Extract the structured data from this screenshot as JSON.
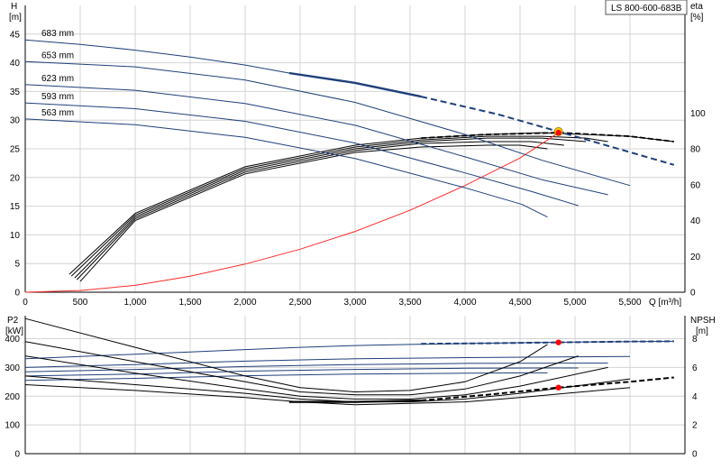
{
  "title_box": "LS 800-600-683B",
  "chart_data": [
    {
      "type": "line",
      "panel": "head-efficiency",
      "xlabel": "Q [m³/h]",
      "ylabel_left": {
        "name": "H",
        "unit": "[m]"
      },
      "ylabel_right": {
        "name": "eta",
        "unit": "[%]"
      },
      "xlim": [
        0,
        6000
      ],
      "ylim_left": [
        0,
        50
      ],
      "ylim_right": [
        0,
        160
      ],
      "x_ticks": [
        0,
        500,
        1000,
        1500,
        2000,
        2500,
        3000,
        3500,
        4000,
        4500,
        5000,
        5500
      ],
      "x_tick_labels": [
        "0",
        "500",
        "1,000",
        "1,500",
        "2,000",
        "2,500",
        "3,000",
        "3,500",
        "4,000",
        "4,500",
        "5,000",
        "5,500"
      ],
      "y_ticks_left": [
        0,
        5,
        10,
        15,
        20,
        25,
        30,
        35,
        40,
        45
      ],
      "y_ticks_right": [
        0,
        20,
        40,
        60,
        80,
        100
      ],
      "grid": true,
      "head_curves": [
        {
          "name": "683 mm",
          "x": [
            0,
            500,
            1000,
            1500,
            2000,
            2400
          ],
          "y": [
            44.0,
            43.2,
            42.2,
            41.0,
            39.6,
            38.2
          ],
          "x2": [
            2400,
            3000,
            3600
          ],
          "y2": [
            38.2,
            36.5,
            34.1
          ],
          "x3": [
            3600,
            4300,
            4850,
            5900
          ],
          "y3": [
            34.1,
            31.0,
            28.0,
            22.2
          ],
          "color": "#1f3f7a"
        },
        {
          "name": "653 mm",
          "x": [
            0,
            1000,
            2000,
            3000,
            4000,
            4700,
            5500
          ],
          "y": [
            40.2,
            39.3,
            37.0,
            33.1,
            27.5,
            23.0,
            18.6
          ],
          "color": "#1f3f7a"
        },
        {
          "name": "623 mm",
          "x": [
            0,
            1000,
            2000,
            3000,
            4000,
            4700,
            5300
          ],
          "y": [
            36.2,
            35.2,
            32.9,
            29.1,
            23.6,
            19.6,
            17.0
          ],
          "color": "#1f3f7a"
        },
        {
          "name": "593 mm",
          "x": [
            0,
            1000,
            2000,
            3000,
            4000,
            4600,
            5030
          ],
          "y": [
            33.0,
            32.0,
            29.8,
            26.0,
            20.8,
            17.6,
            15.1
          ],
          "color": "#1f3f7a"
        },
        {
          "name": "563 mm",
          "x": [
            0,
            1000,
            2000,
            3000,
            4000,
            4520,
            4750
          ],
          "y": [
            30.2,
            29.2,
            27.0,
            23.3,
            18.2,
            15.3,
            13.1
          ],
          "color": "#1f3f7a"
        }
      ],
      "system_curve": {
        "x": [
          0,
          500,
          1000,
          1500,
          2000,
          2500,
          3000,
          3500,
          4000,
          4500,
          4850
        ],
        "y": [
          0,
          0.3,
          1.2,
          2.8,
          4.9,
          7.5,
          10.6,
          14.3,
          18.6,
          23.4,
          27.8
        ],
        "color": "#ff2a2a"
      },
      "eta_curves": [
        {
          "x": [
            400,
            1000,
            2000,
            3000,
            3600,
            4200,
            4700,
            5100,
            5500,
            5900
          ],
          "y": [
            10,
            44,
            70,
            82,
            86,
            88,
            89,
            88,
            87,
            84
          ]
        },
        {
          "x": [
            420,
            1000,
            2000,
            3000,
            3600,
            4200,
            4700,
            5100,
            5300
          ],
          "y": [
            9,
            43,
            69,
            81,
            85,
            87,
            87,
            86,
            84
          ]
        },
        {
          "x": [
            450,
            1000,
            2000,
            3000,
            3600,
            4200,
            4700,
            5100
          ],
          "y": [
            8,
            42,
            68,
            80,
            84,
            86,
            86,
            84
          ]
        },
        {
          "x": [
            470,
            1000,
            2000,
            3000,
            3600,
            4200,
            4600,
            4900
          ],
          "y": [
            7,
            41,
            67,
            79,
            83,
            84,
            84,
            82
          ]
        },
        {
          "x": [
            500,
            1000,
            2000,
            3000,
            3600,
            4200,
            4500,
            4750
          ],
          "y": [
            6,
            40,
            66,
            78,
            81,
            82,
            82,
            80
          ]
        }
      ],
      "eta_dashed_segment": {
        "x": [
          3600,
          4200,
          4850,
          5500,
          5900
        ],
        "y": [
          86,
          88,
          89,
          87,
          84
        ]
      },
      "duty_point": {
        "x": 4850,
        "y": 28.0,
        "color": "#ffcc00"
      },
      "eta_point": {
        "x": 4850,
        "y_eta": 89,
        "color": "#ff0000"
      }
    },
    {
      "type": "line",
      "panel": "power-npsh",
      "ylabel_left": {
        "name": "P2",
        "unit": "[kW]"
      },
      "ylabel_right": {
        "name": "NPSH",
        "unit": "[m]"
      },
      "xlim": [
        0,
        6000
      ],
      "ylim_left": [
        0,
        480
      ],
      "ylim_right": [
        0,
        9.6
      ],
      "y_ticks_left": [
        0,
        100,
        200,
        300,
        400
      ],
      "y_ticks_right": [
        0,
        2,
        4,
        6,
        8
      ],
      "grid": true,
      "power_curves": [
        {
          "x": [
            0,
            500,
            1000,
            1500,
            2000,
            2500,
            3000,
            3500,
            4000,
            4500,
            5000,
            5500,
            5900
          ],
          "y": [
            330,
            338,
            346,
            354,
            362,
            370,
            376,
            380,
            383,
            386,
            388,
            390,
            391
          ],
          "color": "#1f3f7a"
        },
        {
          "x": [
            0,
            1000,
            2000,
            3000,
            4000,
            5000,
            5500
          ],
          "y": [
            300,
            310,
            322,
            330,
            334,
            337,
            338
          ],
          "color": "#1f3f7a"
        },
        {
          "x": [
            0,
            1000,
            2000,
            3000,
            4000,
            5000,
            5300
          ],
          "y": [
            285,
            293,
            303,
            310,
            314,
            315,
            315
          ],
          "color": "#1f3f7a"
        },
        {
          "x": [
            0,
            1000,
            2000,
            3000,
            4000,
            4800,
            5030
          ],
          "y": [
            270,
            277,
            287,
            293,
            297,
            298,
            298
          ],
          "color": "#1f3f7a"
        },
        {
          "x": [
            0,
            1000,
            2000,
            3000,
            4000,
            4600,
            4750
          ],
          "y": [
            255,
            262,
            271,
            277,
            280,
            281,
            281
          ],
          "color": "#1f3f7a"
        }
      ],
      "power_dashed_segment": {
        "x": [
          3600,
          4200,
          4850,
          5500,
          5900
        ],
        "y": [
          382,
          384,
          387,
          390,
          391
        ]
      },
      "npsh_curves": [
        {
          "x": [
            0,
            1000,
            2000,
            2500,
            3000,
            3500,
            4000,
            4500,
            4750
          ],
          "y": [
            9.4,
            7.4,
            5.4,
            4.6,
            4.3,
            4.4,
            5.0,
            6.4,
            7.6
          ]
        },
        {
          "x": [
            0,
            1000,
            2000,
            2500,
            3000,
            3500,
            4000,
            4500,
            5030
          ],
          "y": [
            7.8,
            6.4,
            5.0,
            4.3,
            4.1,
            4.1,
            4.5,
            5.4,
            6.8
          ]
        },
        {
          "x": [
            0,
            1000,
            2000,
            2500,
            3000,
            3500,
            4000,
            4500,
            5300
          ],
          "y": [
            6.8,
            5.6,
            4.5,
            4.0,
            3.8,
            3.8,
            4.1,
            4.7,
            6.0
          ]
        },
        {
          "x": [
            0,
            1000,
            2000,
            2500,
            3000,
            3500,
            4000,
            4500,
            5500
          ],
          "y": [
            5.4,
            4.8,
            4.2,
            3.8,
            3.6,
            3.6,
            3.8,
            4.2,
            5.2
          ]
        },
        {
          "x": [
            0,
            1000,
            2000,
            2500,
            3000,
            3500,
            4000,
            4500,
            5500
          ],
          "y": [
            4.8,
            4.4,
            3.9,
            3.6,
            3.4,
            3.5,
            3.6,
            3.9,
            4.6
          ]
        }
      ],
      "npsh_bold_curve": {
        "x": [
          2400,
          3000,
          3600
        ],
        "y": [
          3.6,
          3.6,
          3.7
        ]
      },
      "npsh_dashed_segment": {
        "x": [
          3600,
          4200,
          4850,
          5500,
          5900
        ],
        "y": [
          3.7,
          4.1,
          4.6,
          5.0,
          5.3
        ]
      },
      "power_point": {
        "x": 4850,
        "y": 387,
        "color": "#ff0000"
      },
      "npsh_point": {
        "x": 4850,
        "y_npsh": 4.6,
        "color": "#ff0000"
      }
    }
  ]
}
